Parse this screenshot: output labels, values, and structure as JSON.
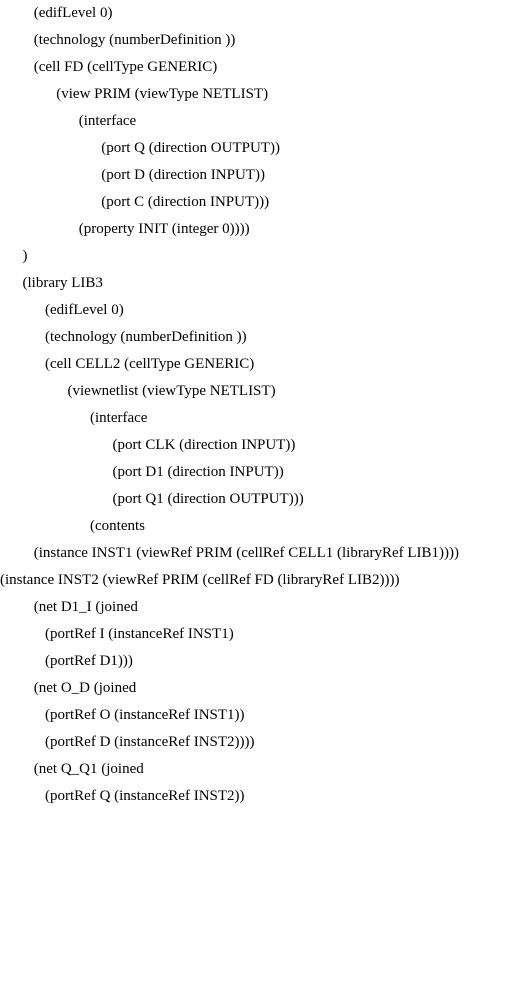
{
  "lines": [
    {
      "indent": 3,
      "text": "(edifLevel 0)"
    },
    {
      "indent": 3,
      "text": "(technology (numberDefinition ))"
    },
    {
      "indent": 3,
      "text": "(cell FD (cellType GENERIC)"
    },
    {
      "indent": 5,
      "text": "(view PRIM (viewType NETLIST)"
    },
    {
      "indent": 7,
      "text": "(interface"
    },
    {
      "indent": 9,
      "text": "(port Q (direction OUTPUT))"
    },
    {
      "indent": 9,
      "text": "(port D (direction INPUT))"
    },
    {
      "indent": 9,
      "text": "(port C (direction INPUT)))"
    },
    {
      "indent": 7,
      "text": "(property INIT (integer 0))))"
    },
    {
      "indent": 2,
      "text": ")"
    },
    {
      "indent": 2,
      "text": "(library LIB3"
    },
    {
      "indent": 4,
      "text": "(edifLevel 0)"
    },
    {
      "indent": 4,
      "text": "(technology (numberDefinition ))"
    },
    {
      "indent": 4,
      "text": "(cell CELL2 (cellType GENERIC)"
    },
    {
      "indent": 6,
      "text": "(viewnetlist (viewType NETLIST)"
    },
    {
      "indent": 8,
      "text": "(interface"
    },
    {
      "indent": 10,
      "text": "(port CLK (direction INPUT))"
    },
    {
      "indent": 10,
      "text": "(port D1 (direction INPUT))"
    },
    {
      "indent": 10,
      "text": "(port Q1 (direction OUTPUT)))"
    },
    {
      "indent": 8,
      "text": "(contents"
    },
    {
      "indent": 3,
      "text": "(instance INST1 (viewRef PRIM (cellRef CELL1 (libraryRef LIB1))))"
    },
    {
      "indent": 0,
      "text": "(instance INST2 (viewRef PRIM (cellRef FD (libraryRef LIB2))))"
    },
    {
      "indent": 3,
      "text": "(net D1_I (joined"
    },
    {
      "indent": 4,
      "text": "(portRef I (instanceRef INST1)"
    },
    {
      "indent": 4,
      "text": "(portRef D1)))"
    },
    {
      "indent": 3,
      "text": "(net O_D (joined"
    },
    {
      "indent": 4,
      "text": "(portRef O (instanceRef INST1))"
    },
    {
      "indent": 4,
      "text": "(portRef D (instanceRef INST2))))"
    },
    {
      "indent": 3,
      "text": "(net Q_Q1 (joined"
    },
    {
      "indent": 4,
      "text": "(portRef Q (instanceRef INST2))"
    }
  ]
}
